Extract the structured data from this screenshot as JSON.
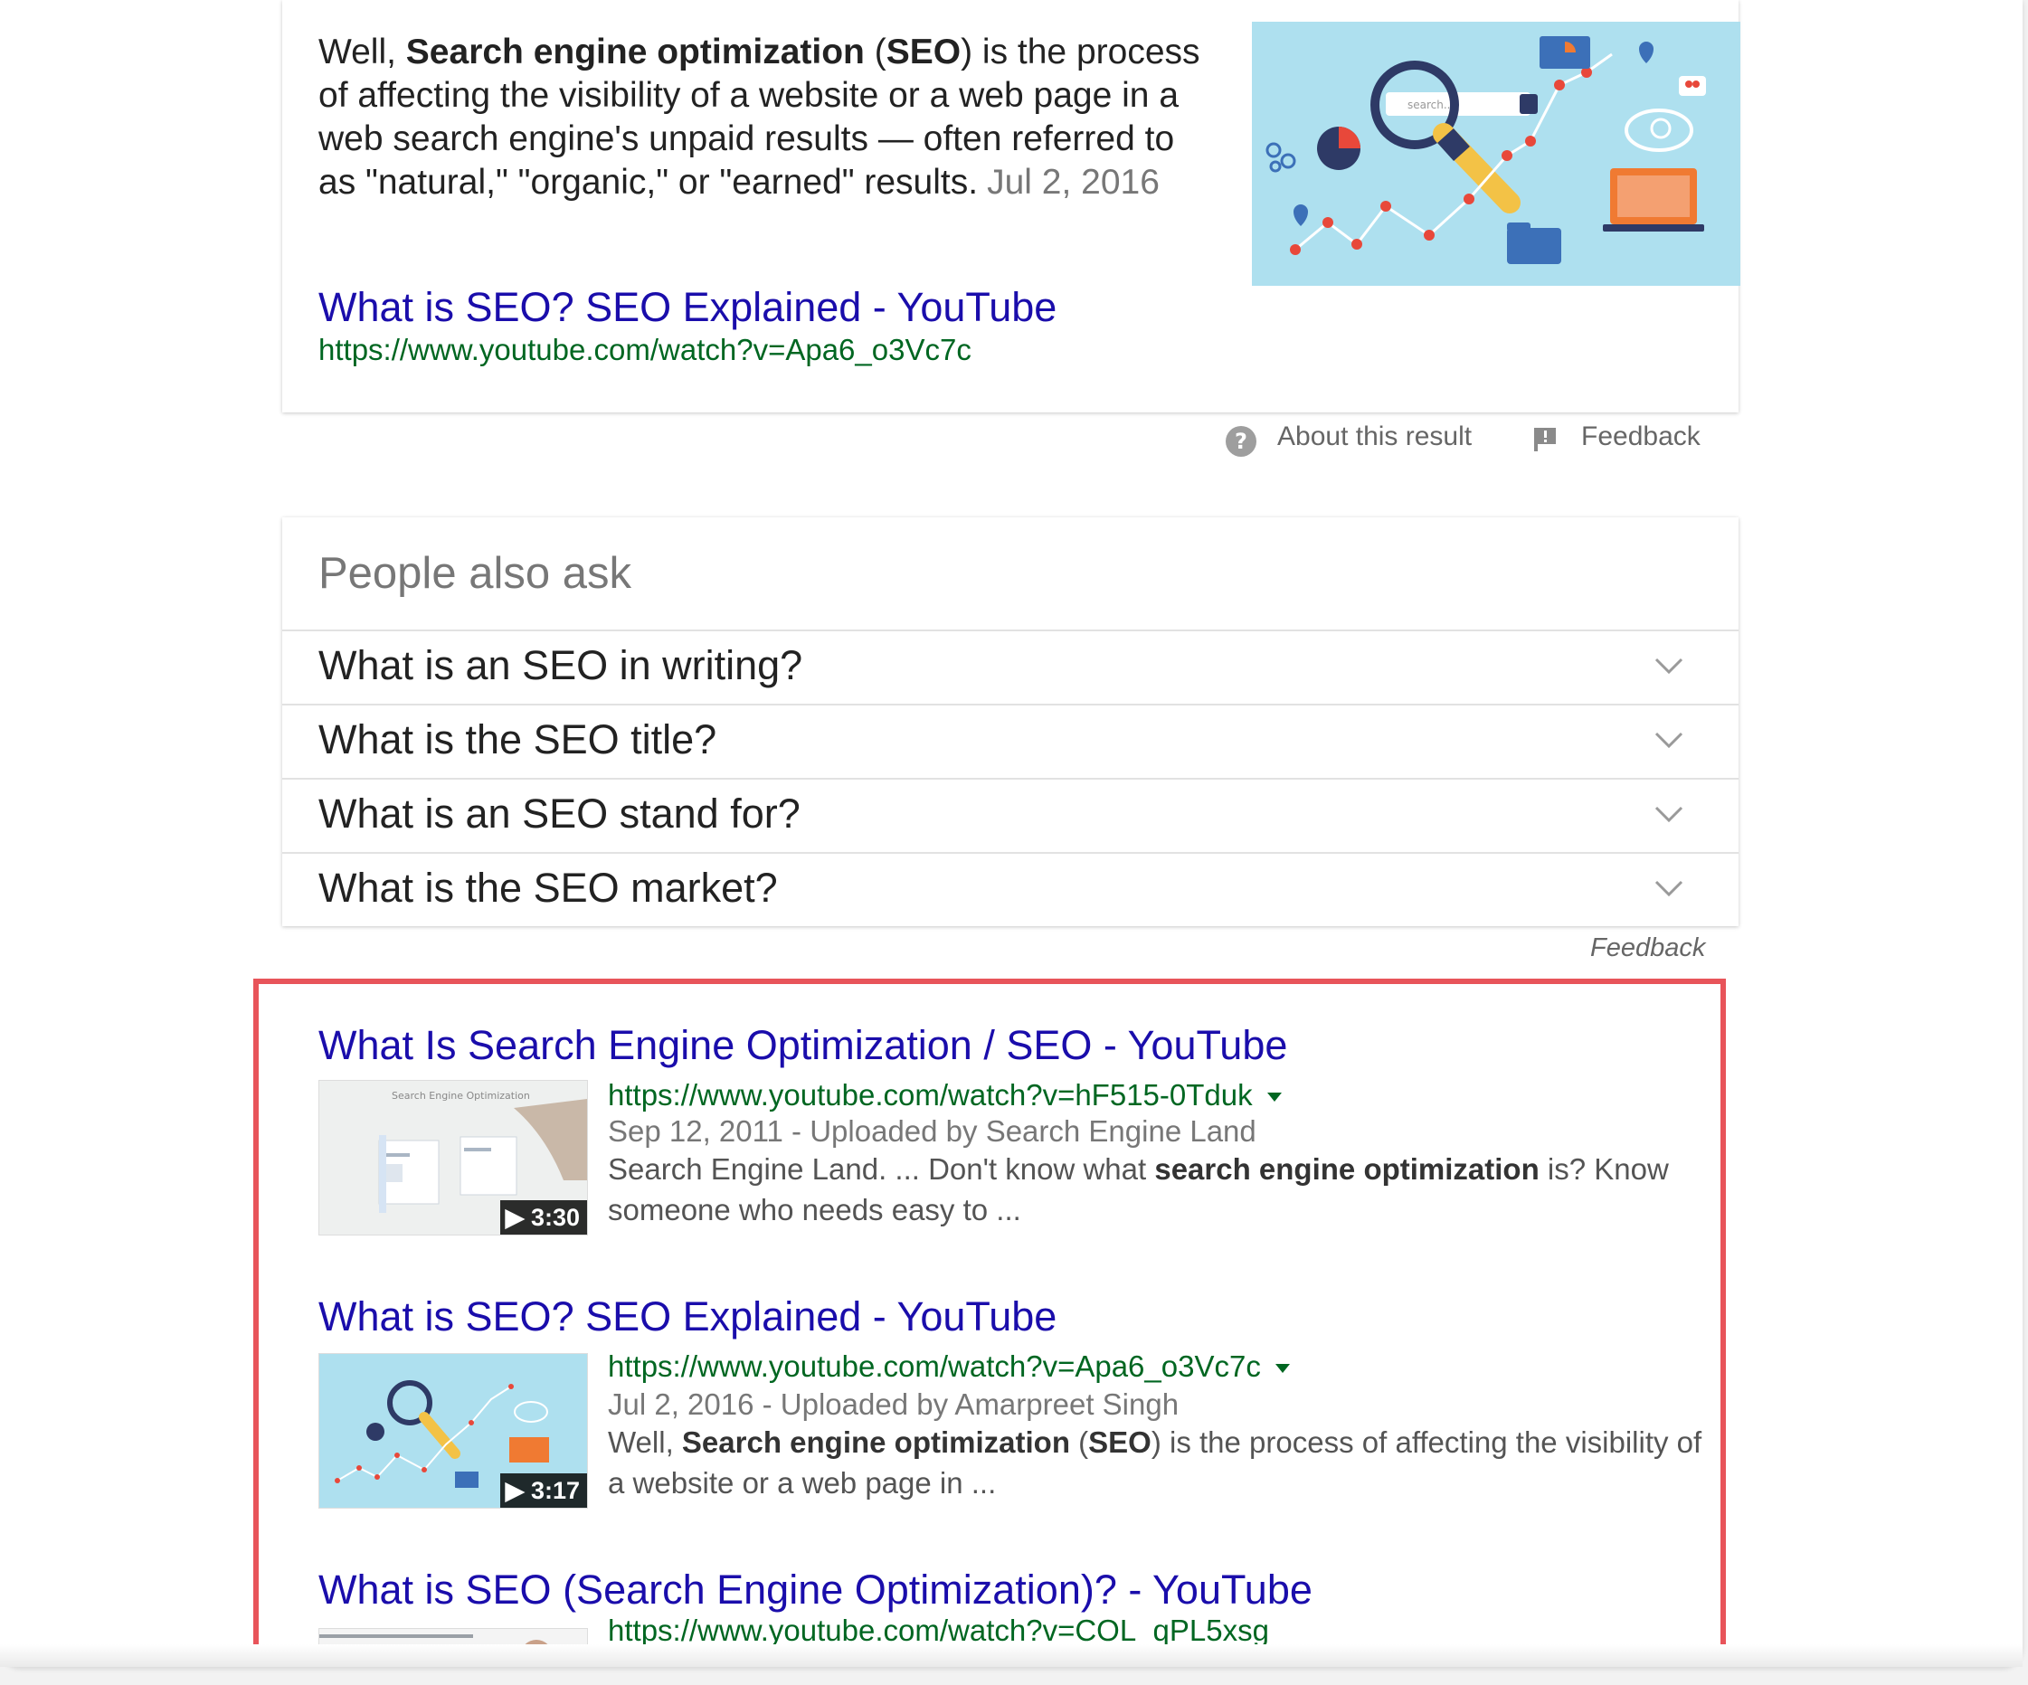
{
  "featured_snippet": {
    "text_before": "Well, ",
    "text_bold": "Search engine optimization",
    "text_middle": " (",
    "text_bold2": "SEO",
    "text_after": ") is the process of affecting the visibility of a website or a web page in a web search engine's unpaid results — often referred to as \"natural,\" \"organic,\" or \"earned\" results.",
    "date": "Jul 2, 2016",
    "link_title": "What is SEO? SEO Explained - YouTube",
    "link_url": "https://www.youtube.com/watch?v=Apa6_o3Vc7c",
    "image_search_text": "search...",
    "about_label": "About this result",
    "feedback_label": "Feedback"
  },
  "people_also_ask": {
    "title": "People also ask",
    "questions": [
      "What is an SEO in writing?",
      "What is the SEO title?",
      "What is an SEO stand for?",
      "What is the SEO market?"
    ],
    "feedback_label": "Feedback"
  },
  "video_results": [
    {
      "title": "What Is Search Engine Optimization / SEO - YouTube",
      "url": "https://www.youtube.com/watch?v=hF515-0Tduk",
      "meta": "Sep 12, 2011 - Uploaded by Search Engine Land",
      "desc_before": "Search Engine Land. ... Don't know what ",
      "desc_bold": "search engine optimization",
      "desc_after": " is? Know someone who needs easy to ...",
      "duration": "3:30",
      "thumb_text": "Search Engine Optimization"
    },
    {
      "title": "What is SEO? SEO Explained - YouTube",
      "url": "https://www.youtube.com/watch?v=Apa6_o3Vc7c",
      "meta": "Jul 2, 2016 - Uploaded by Amarpreet Singh",
      "desc_before": "Well, ",
      "desc_bold": "Search engine optimization",
      "desc_middle": " (",
      "desc_bold2": "SEO",
      "desc_after": ") is the process of affecting the visibility of a website or a web page in ...",
      "duration": "3:17"
    },
    {
      "title": "What is SEO (Search Engine Optimization)? - YouTube",
      "url": "https://www.youtube.com/watch?v=COL_qPL5xsg"
    }
  ],
  "colors": {
    "link": "#1a0dab",
    "url": "#006621",
    "highlight": "#e8545a"
  }
}
